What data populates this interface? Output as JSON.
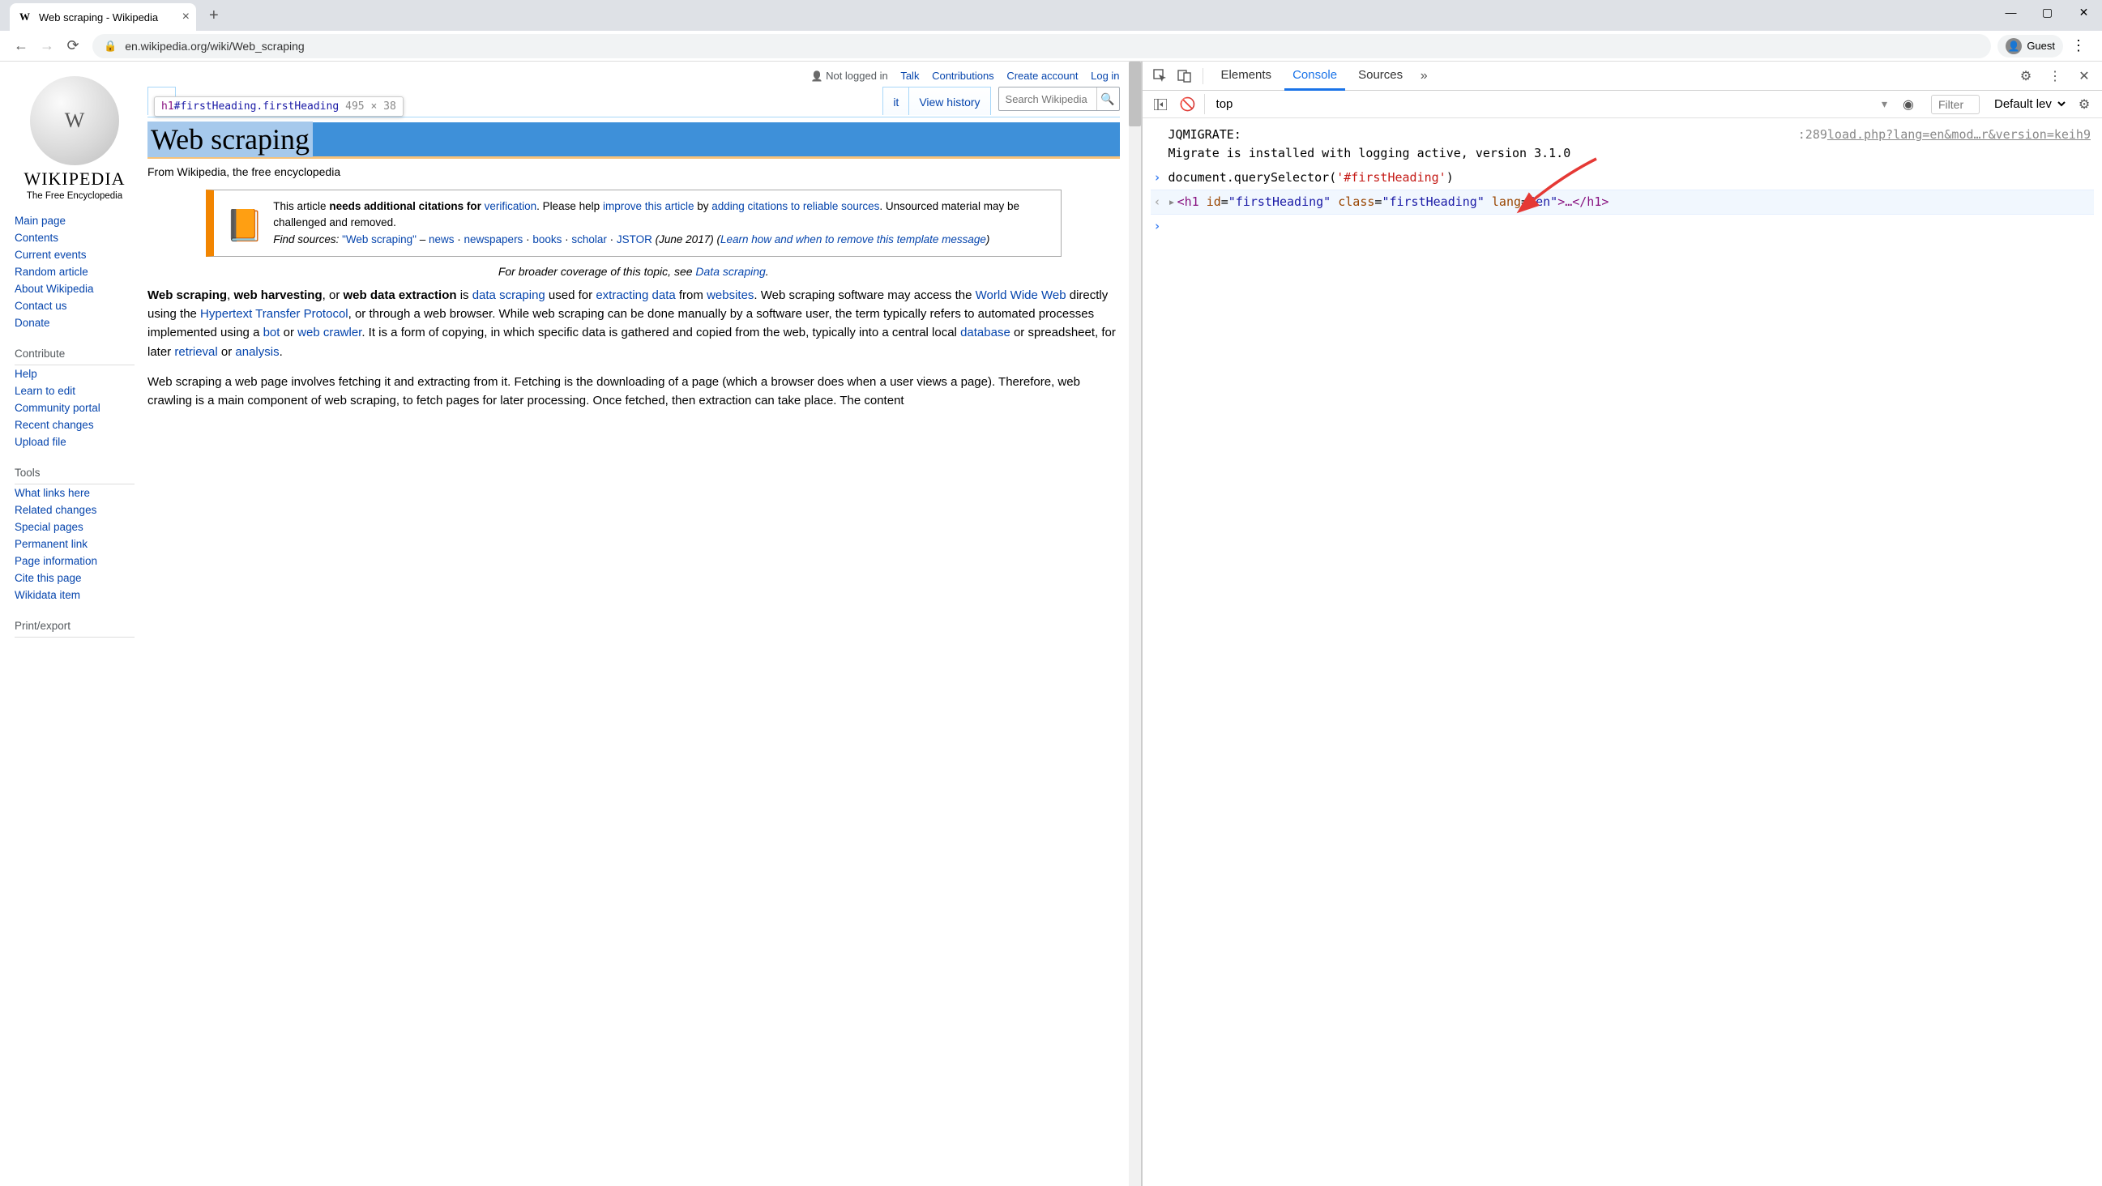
{
  "browser": {
    "tab_title": "Web scraping - Wikipedia",
    "url": "en.wikipedia.org/wiki/Web_scraping",
    "guest_label": "Guest"
  },
  "wiki": {
    "wordmark": "WIKIPEDIA",
    "tagline": "The Free Encyclopedia",
    "personal": {
      "anon": "Not logged in",
      "talk": "Talk",
      "contrib": "Contributions",
      "create": "Create account",
      "login": "Log in"
    },
    "tabs": {
      "article_hint": "A",
      "edit_suffix": "it",
      "history": "View history"
    },
    "search_placeholder": "Search Wikipedia",
    "sidenav": [
      {
        "heading": "",
        "items": [
          "Main page",
          "Contents",
          "Current events",
          "Random article",
          "About Wikipedia",
          "Contact us",
          "Donate"
        ]
      },
      {
        "heading": "Contribute",
        "items": [
          "Help",
          "Learn to edit",
          "Community portal",
          "Recent changes",
          "Upload file"
        ]
      },
      {
        "heading": "Tools",
        "items": [
          "What links here",
          "Related changes",
          "Special pages",
          "Permanent link",
          "Page information",
          "Cite this page",
          "Wikidata item"
        ]
      },
      {
        "heading": "Print/export",
        "items": []
      }
    ],
    "tooltip": {
      "selector_tag": "h1",
      "selector_rest": "#firstHeading.firstHeading",
      "dims": "495 × 38"
    },
    "heading": "Web scraping",
    "sitesub": "From Wikipedia, the free encyclopedia",
    "ambox": {
      "t1": "This article ",
      "bold1": "needs additional citations for ",
      "link1": "verification",
      "t2": ". Please help ",
      "link2": "improve this article",
      "t3": " by ",
      "link3": "adding citations to reliable sources",
      "t4": ". Unsourced material may be challenged and removed.",
      "find": "Find sources: ",
      "q": "\"Web scraping\"",
      "dash": " – ",
      "src": [
        "news",
        "newspapers",
        "books",
        "scholar",
        "JSTOR"
      ],
      "date": "(June 2017)",
      "learn": "Learn how and when to remove this template message"
    },
    "hatnote_pre": "For broader coverage of this topic, see ",
    "hatnote_link": "Data scraping",
    "article": {
      "b1": "Web scraping",
      "c1": ", ",
      "b2": "web harvesting",
      "c2": ", or ",
      "b3": "web data extraction",
      "c3": " is ",
      "l1": "data scraping",
      "c4": " used for ",
      "l2": "extracting data",
      "c5": " from ",
      "l3": "websites",
      "c6": ". Web scraping software may access the ",
      "l4": "World Wide Web",
      "c7": " directly using the ",
      "l5": "Hypertext Transfer Protocol",
      "c8": ", or through a web browser. While web scraping can be done manually by a software user, the term typically refers to automated processes implemented using a ",
      "l6": "bot",
      "c9": " or ",
      "l7": "web crawler",
      "c10": ". It is a form of copying, in which specific data is gathered and copied from the web, typically into a central local ",
      "l8": "database",
      "c11": " or spreadsheet, for later ",
      "l9": "retrieval",
      "c12": " or ",
      "l10": "analysis",
      "c13": ".",
      "p2": "Web scraping a web page involves fetching it and extracting from it. Fetching is the downloading of a page (which a browser does when a user views a page). Therefore, web crawling is a main component of web scraping, to fetch pages for later processing. Once fetched, then extraction can take place. The content"
    }
  },
  "devtools": {
    "tabs": [
      "Elements",
      "Console",
      "Sources"
    ],
    "active_tab": "Console",
    "context": "top",
    "filter_placeholder": "Filter",
    "level": "Default lev",
    "log_prefix": "JQMIGRATE: ",
    "log_link": "load.php?lang=en&mod…r&version=keih9",
    "log_linepos": ":289",
    "log_body": "Migrate is installed with logging active, version 3.1.0",
    "input_pre": "document.querySelector(",
    "input_str": "'#firstHeading'",
    "input_post": ")",
    "result_tag_open": "<h1 ",
    "result_id_k": "id",
    "result_id_v": "\"firstHeading\"",
    "result_class_k": "class",
    "result_class_v": "\"firstHeading\"",
    "result_lang_k": "lang",
    "result_lang_v": "\"en\"",
    "result_ellipsis": ">…</h1>"
  }
}
